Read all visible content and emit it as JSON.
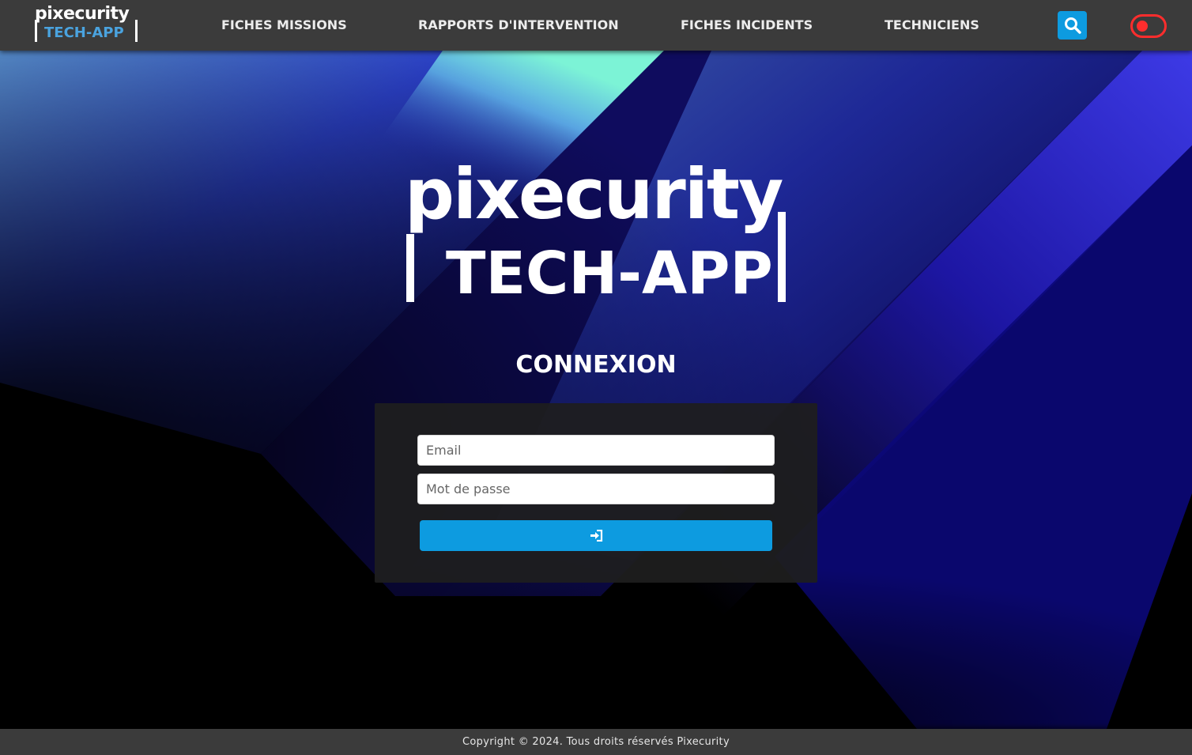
{
  "brand": {
    "line1": "pixecurity",
    "line2": "TECH-APP",
    "accent": "#4aa3df"
  },
  "nav": {
    "items": [
      {
        "label": "FICHES MISSIONS"
      },
      {
        "label": "RAPPORTS D'INTERVENTION"
      },
      {
        "label": "FICHES INCIDENTS"
      },
      {
        "label": "TECHNICIENS"
      }
    ],
    "search_icon": "search-icon",
    "toggle_color": "#ff2d2d",
    "button_color": "#0d9be0"
  },
  "hero": {
    "logo_line1": "pixecurity",
    "logo_line2": "TECH-APP"
  },
  "login": {
    "title": "CONNEXION",
    "email_placeholder": "Email",
    "password_placeholder": "Mot de passe",
    "submit_icon": "sign-in-icon"
  },
  "footer": {
    "text": "Copyright © 2024. Tous droits réservés Pixecurity"
  }
}
